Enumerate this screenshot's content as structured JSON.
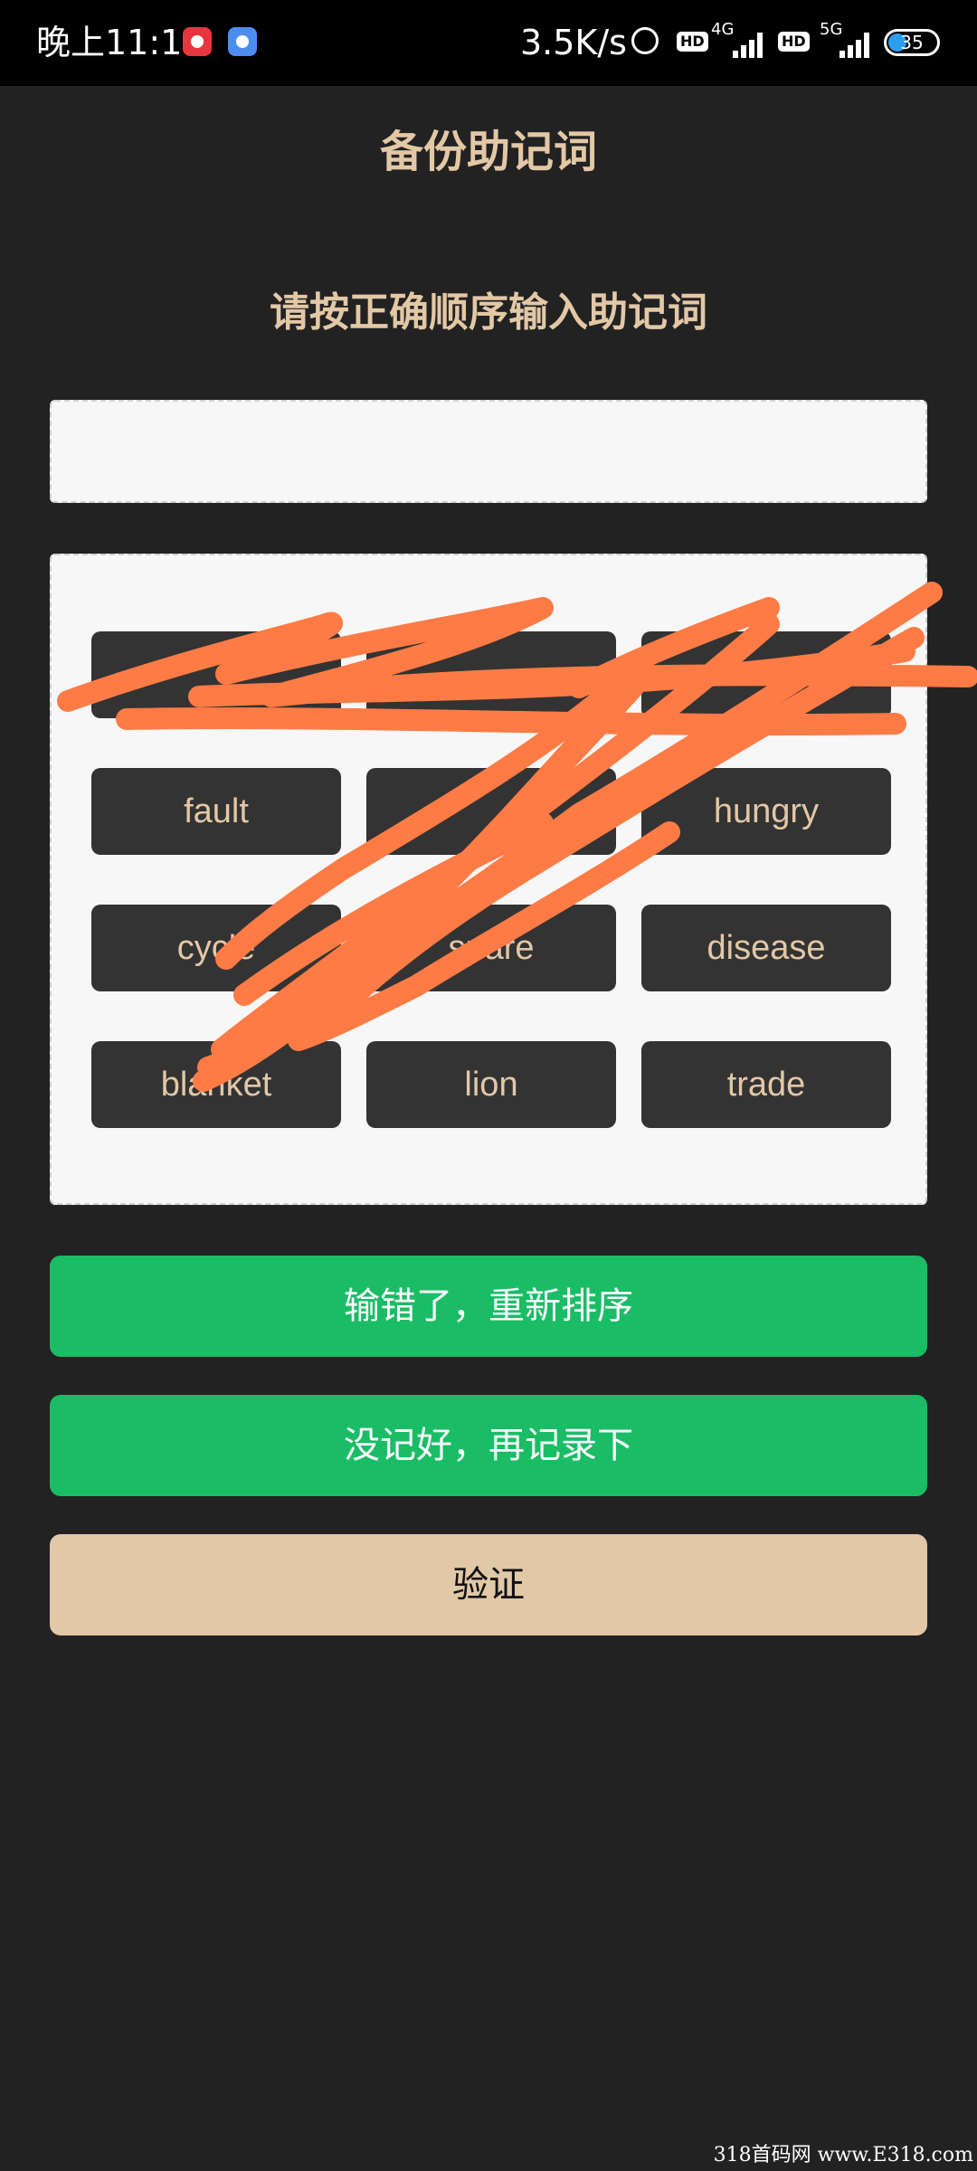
{
  "status_bar": {
    "time": "晚上11:17",
    "net_speed": "3.5K/s",
    "hd_badge_1": "HD",
    "hd_badge_2": "HD",
    "gen_1": "4G",
    "gen_2": "5G",
    "battery": "35"
  },
  "header": {
    "title": "备份助记词"
  },
  "instruction": "请按正确顺序输入助记词",
  "input": {
    "value": ""
  },
  "words": [
    "",
    "",
    "",
    "fault",
    "",
    "hungry",
    "cycle",
    "spare",
    "disease",
    "blanket",
    "lion",
    "trade"
  ],
  "buttons": {
    "reorder": "输错了，重新排序",
    "rerecord": "没记好，再记录下",
    "verify": "验证"
  },
  "watermark": "318首码网 www.E318.com",
  "colors": {
    "background": "#222222",
    "accent_text": "#e3c8a6",
    "chip": "#333333",
    "green": "#1abd66",
    "verify": "#e1c8a6",
    "scribble": "#ff7b45"
  }
}
